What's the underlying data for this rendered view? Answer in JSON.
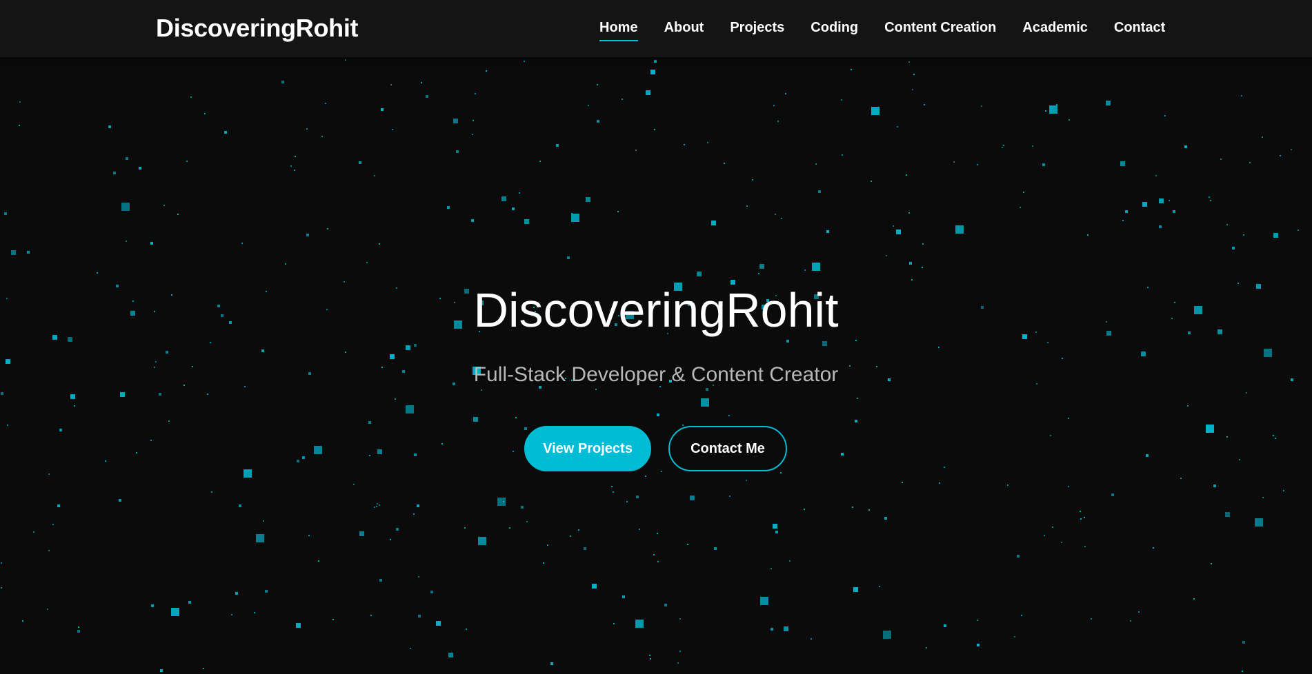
{
  "theme": {
    "background": "#0b0b0c",
    "navbar_background": "#141415",
    "accent": "#00bcd4",
    "particle_color": "#00bcd4",
    "text_primary": "#ffffff",
    "text_secondary": "#b8b8b8"
  },
  "navbar": {
    "brand": "DiscoveringRohit",
    "links": [
      {
        "label": "Home",
        "active": true
      },
      {
        "label": "About",
        "active": false
      },
      {
        "label": "Projects",
        "active": false
      },
      {
        "label": "Coding",
        "active": false
      },
      {
        "label": "Content Creation",
        "active": false
      },
      {
        "label": "Academic",
        "active": false
      },
      {
        "label": "Contact",
        "active": false
      }
    ]
  },
  "hero": {
    "title": "DiscoveringRohit",
    "subtitle": "Full-Stack Developer & Content Creator",
    "primary_button": "View Projects",
    "secondary_button": "Contact Me"
  },
  "background": {
    "effect": "particle-field"
  }
}
